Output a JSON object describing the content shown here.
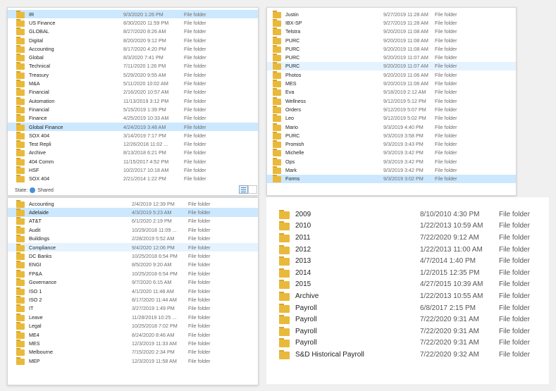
{
  "panels": {
    "top_left": {
      "rows": [
        {
          "name": "IR",
          "date": "9/3/2020 1:26 PM",
          "type": "File folder"
        },
        {
          "name": "US Finance",
          "date": "8/30/2020 11:59 PM",
          "type": "File folder"
        },
        {
          "name": "GLOBAL",
          "date": "8/27/2020 8:26 AM",
          "type": "File folder"
        },
        {
          "name": "Digital",
          "date": "8/20/2020 9:12 PM",
          "type": "File folder"
        },
        {
          "name": "Accounting",
          "date": "8/17/2020 4:20 PM",
          "type": "File folder"
        },
        {
          "name": "Global",
          "date": "8/3/2020 7:41 PM",
          "type": "File folder"
        },
        {
          "name": "Technical",
          "date": "7/11/2020 1:26 PM",
          "type": "File folder"
        },
        {
          "name": "Treasury",
          "date": "5/29/2020 9:55 AM",
          "type": "File folder"
        },
        {
          "name": "M&A",
          "date": "5/11/2020 10:02 AM",
          "type": "File folder"
        },
        {
          "name": "Financial",
          "date": "2/16/2020 10:57 AM",
          "type": "File folder"
        },
        {
          "name": "Automation",
          "date": "11/13/2019 3:12 PM",
          "type": "File folder"
        },
        {
          "name": "Financial",
          "date": "5/15/2019 1:39 PM",
          "type": "File folder"
        },
        {
          "name": "Finance",
          "date": "4/25/2019 10:33 AM",
          "type": "File folder"
        },
        {
          "name": "Global Finance",
          "date": "4/24/2019 3:48 AM",
          "type": "File folder"
        },
        {
          "name": "SOX 404",
          "date": "3/14/2019 7:17 PM",
          "type": "File folder"
        },
        {
          "name": "Test Repli",
          "date": "12/26/2018 11:02 ...",
          "type": "File folder"
        },
        {
          "name": "Archive",
          "date": "8/13/2018 6:21 PM",
          "type": "File folder"
        },
        {
          "name": "404 Comm",
          "date": "11/15/2017 4:52 PM",
          "type": "File folder"
        },
        {
          "name": "HSF",
          "date": "10/2/2017 10:18 AM",
          "type": "File folder"
        },
        {
          "name": "SOX 404",
          "date": "2/21/2014 1:22 PM",
          "type": "File folder"
        }
      ],
      "status_label": "State:",
      "status_value": "Shared"
    },
    "top_right": {
      "rows": [
        {
          "name": "Justin",
          "date": "9/27/2019 11:28 AM",
          "type": "File folder"
        },
        {
          "name": "IBX-SP",
          "date": "9/27/2019 11:28 AM",
          "type": "File folder"
        },
        {
          "name": "Telstra",
          "date": "9/20/2019 11:08 AM",
          "type": "File folder"
        },
        {
          "name": "PURC",
          "date": "9/20/2019 11:08 AM",
          "type": "File folder"
        },
        {
          "name": "PURC",
          "date": "9/20/2019 11:08 AM",
          "type": "File folder"
        },
        {
          "name": "PURC",
          "date": "9/20/2019 11:07 AM",
          "type": "File folder"
        },
        {
          "name": "PURC",
          "date": "9/20/2019 11:07 AM",
          "type": "File folder"
        },
        {
          "name": "Photos",
          "date": "9/20/2019 11:06 AM",
          "type": "File folder"
        },
        {
          "name": "MES",
          "date": "9/20/2019 11:06 AM",
          "type": "File folder"
        },
        {
          "name": "Eva",
          "date": "9/18/2019 2:12 AM",
          "type": "File folder"
        },
        {
          "name": "Wellness",
          "date": "9/12/2019 5:12 PM",
          "type": "File folder"
        },
        {
          "name": "Orders",
          "date": "9/12/2019 5:07 PM",
          "type": "File folder"
        },
        {
          "name": "Leo",
          "date": "9/12/2019 5:02 PM",
          "type": "File folder"
        },
        {
          "name": "Mario",
          "date": "9/3/2019 4:40 PM",
          "type": "File folder"
        },
        {
          "name": "PURC",
          "date": "9/3/2019 3:58 PM",
          "type": "File folder"
        },
        {
          "name": "Promish",
          "date": "9/3/2019 3:43 PM",
          "type": "File folder"
        },
        {
          "name": "Michelle",
          "date": "9/3/2019 3:42 PM",
          "type": "File folder"
        },
        {
          "name": "Ops",
          "date": "9/3/2019 3:42 PM",
          "type": "File folder"
        },
        {
          "name": "Mark",
          "date": "9/3/2019 3:42 PM",
          "type": "File folder"
        },
        {
          "name": "Forms",
          "date": "9/3/2019 3:02 PM",
          "type": "File folder"
        }
      ]
    },
    "bottom_left": {
      "rows": [
        {
          "name": "Accounting",
          "date": "2/4/2019 12:39 PM",
          "type": "File folder"
        },
        {
          "name": "Adelaide",
          "date": "4/3/2019 5:23 AM",
          "type": "File folder"
        },
        {
          "name": "AT&T",
          "date": "6/1/2020 2:19 PM",
          "type": "File folder"
        },
        {
          "name": "Audit",
          "date": "10/29/2018 11:09 ...",
          "type": "File folder"
        },
        {
          "name": "Buildings",
          "date": "2/28/2019 5:52 AM",
          "type": "File folder"
        },
        {
          "name": "Compliance",
          "date": "9/4/2020 12:06 PM",
          "type": "File folder"
        },
        {
          "name": "DC Banks",
          "date": "10/25/2018 6:54 PM",
          "type": "File folder"
        },
        {
          "name": "ENGI",
          "date": "8/5/2020 9:20 AM",
          "type": "File folder"
        },
        {
          "name": "FP&A",
          "date": "10/25/2018 6:54 PM",
          "type": "File folder"
        },
        {
          "name": "Governance",
          "date": "9/7/2020 6:15 AM",
          "type": "File folder"
        },
        {
          "name": "ISO 1",
          "date": "4/1/2020 11:48 AM",
          "type": "File folder"
        },
        {
          "name": "ISO 2",
          "date": "8/17/2020 11:44 AM",
          "type": "File folder"
        },
        {
          "name": "IT",
          "date": "3/27/2019 1:49 PM",
          "type": "File folder"
        },
        {
          "name": "Leave",
          "date": "11/28/2019 10:25 ...",
          "type": "File folder"
        },
        {
          "name": "Legal",
          "date": "10/25/2018 7:02 PM",
          "type": "File folder"
        },
        {
          "name": "ME4",
          "date": "8/24/2020 8:46 AM",
          "type": "File folder"
        },
        {
          "name": "MES",
          "date": "12/3/2019 11:33 AM",
          "type": "File folder"
        },
        {
          "name": "Melbourne",
          "date": "7/15/2020 2:34 PM",
          "type": "File folder"
        },
        {
          "name": "MEP",
          "date": "12/3/2019 11:58 AM",
          "type": "File folder"
        }
      ]
    },
    "bottom_right": {
      "rows": [
        {
          "name": "2009",
          "date": "8/10/2010 4:30 PM",
          "type": "File folder"
        },
        {
          "name": "2010",
          "date": "1/22/2013 10:59 AM",
          "type": "File folder"
        },
        {
          "name": "2011",
          "date": "7/22/2020 9:12 AM",
          "type": "File folder"
        },
        {
          "name": "2012",
          "date": "1/22/2013 11:00 AM",
          "type": "File folder"
        },
        {
          "name": "2013",
          "date": "4/7/2014 1:40 PM",
          "type": "File folder"
        },
        {
          "name": "2014",
          "date": "1/2/2015 12:35 PM",
          "type": "File folder"
        },
        {
          "name": "2015",
          "date": "4/27/2015 10:39 AM",
          "type": "File folder"
        },
        {
          "name": "Archive",
          "date": "1/22/2013 10:55 AM",
          "type": "File folder"
        },
        {
          "name": "Payroll",
          "date": "6/8/2017 2:15 PM",
          "type": "File folder"
        },
        {
          "name": "Payroll",
          "date": "7/22/2020 9:31 AM",
          "type": "File folder"
        },
        {
          "name": "Payroll",
          "date": "7/22/2020 9:31 AM",
          "type": "File folder"
        },
        {
          "name": "Payroll",
          "date": "7/22/2020 9:31 AM",
          "type": "File folder"
        },
        {
          "name": "S&D Historical Payroll",
          "date": "7/22/2020 9:32 AM",
          "type": "File folder"
        }
      ]
    }
  },
  "colors": {
    "selected": "#cce8ff",
    "hover": "#e5f3ff",
    "folder": "#e9b93b"
  }
}
